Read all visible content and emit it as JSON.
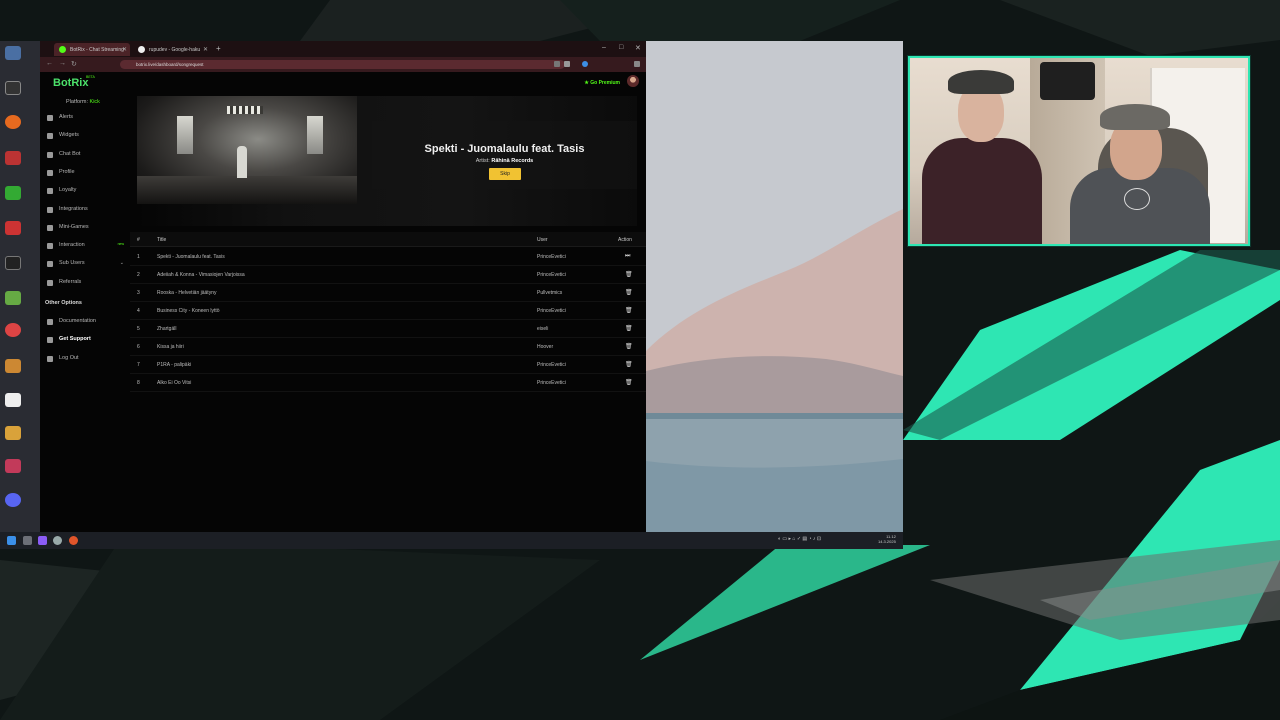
{
  "browser": {
    "tabs": [
      {
        "label": "BotRix - Chat Streaming",
        "active": true
      },
      {
        "label": "rupudev - Google-haku",
        "active": false
      }
    ],
    "url": "botrix.live/dashboard/songrequest"
  },
  "app": {
    "logo": "BotRix",
    "logo_badge": "BETA",
    "platform_label": "Platform:",
    "platform_value": "Kick",
    "premium_label": "Go Premium",
    "accent_color": "#53fc18"
  },
  "sidebar": {
    "items": [
      {
        "label": "Alerts",
        "icon": "bell-icon"
      },
      {
        "label": "Widgets",
        "icon": "widgets-icon"
      },
      {
        "label": "Chat Bot",
        "icon": "robot-icon"
      },
      {
        "label": "Profile",
        "icon": "user-icon"
      },
      {
        "label": "Loyalty",
        "icon": "gift-icon"
      },
      {
        "label": "Integrations",
        "icon": "plug-icon"
      },
      {
        "label": "Mini-Games",
        "icon": "gamepad-icon"
      },
      {
        "label": "Interaction",
        "icon": "music-icon",
        "tag": "new"
      },
      {
        "label": "Sub Users",
        "icon": "users-icon"
      },
      {
        "label": "Referrals",
        "icon": "referral-icon"
      }
    ],
    "other_options_title": "Other Options",
    "other_items": [
      {
        "label": "Documentation",
        "icon": "book-icon"
      },
      {
        "label": "Get Support",
        "icon": "support-icon"
      },
      {
        "label": "Log Out",
        "icon": "logout-icon"
      }
    ]
  },
  "now_playing": {
    "title": "Spekti - Juomalaulu feat. Tasis",
    "artist_label": "Artist:",
    "artist": "Rähinä Records",
    "skip_label": "Skip"
  },
  "queue": {
    "headers": {
      "num": "#",
      "title": "Title",
      "user": "User",
      "action": "Action"
    },
    "rows": [
      {
        "num": "1",
        "title": "Spekti - Juomalaulu feat. Tasis",
        "user": "PrinceEvetici"
      },
      {
        "num": "2",
        "title": "Adeiiah & Konna - Vimasiojen Varjoissa",
        "user": "PrinceEvetici"
      },
      {
        "num": "3",
        "title": "Rooska - Helvetiän jäätyny",
        "user": "Pullvetmics"
      },
      {
        "num": "4",
        "title": "Business City - Koneen lyttö",
        "user": "PrinceEvetici"
      },
      {
        "num": "5",
        "title": "Zhartgäll",
        "user": "eiseli"
      },
      {
        "num": "6",
        "title": "Kissa ja hiiri",
        "user": "Hoover"
      },
      {
        "num": "7",
        "title": "P1RA - palipäki",
        "user": "PrinceEvetici"
      },
      {
        "num": "8",
        "title": "Alko Ei Oo Vitsi",
        "user": "PrinceEvetici"
      }
    ]
  },
  "taskbar": {
    "clock": "11.12",
    "date": "14.3.2025"
  }
}
